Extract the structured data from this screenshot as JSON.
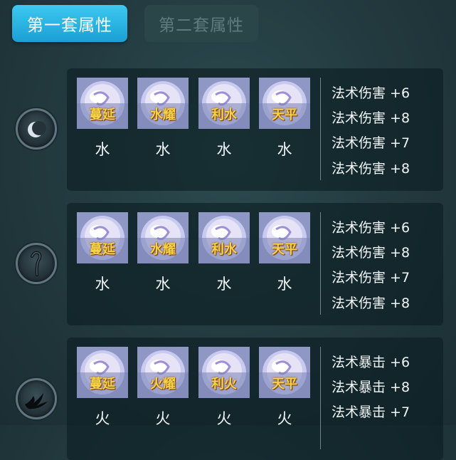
{
  "tabs": [
    {
      "label": "第一套属性",
      "active": true
    },
    {
      "label": "第二套属性",
      "active": false
    }
  ],
  "rows": [
    {
      "slot_icon": "crescent-moon-icon",
      "gems": [
        {
          "name": "蔓延",
          "element": "水"
        },
        {
          "name": "水耀",
          "element": "水"
        },
        {
          "name": "利水",
          "element": "水"
        },
        {
          "name": "天平",
          "element": "水"
        }
      ],
      "stats": [
        "法术伤害 +6",
        "法术伤害 +8",
        "法术伤害 +7",
        "法术伤害 +8"
      ]
    },
    {
      "slot_icon": "hook-icon",
      "gems": [
        {
          "name": "蔓延",
          "element": "水"
        },
        {
          "name": "水耀",
          "element": "水"
        },
        {
          "name": "利水",
          "element": "水"
        },
        {
          "name": "天平",
          "element": "水"
        }
      ],
      "stats": [
        "法术伤害 +6",
        "法术伤害 +8",
        "法术伤害 +7",
        "法术伤害 +8"
      ]
    },
    {
      "slot_icon": "claw-icon",
      "gems": [
        {
          "name": "蔓延",
          "element": "火"
        },
        {
          "name": "火耀",
          "element": "火"
        },
        {
          "name": "利火",
          "element": "火"
        },
        {
          "name": "天平",
          "element": "火"
        }
      ],
      "stats": [
        "法术暴击 +6",
        "法术暴击 +8",
        "法术暴击 +7"
      ]
    }
  ],
  "colors": {
    "tab_active": "#1aa0d4",
    "gem_name": "#f3d34a",
    "panel": "#0a1c22"
  }
}
